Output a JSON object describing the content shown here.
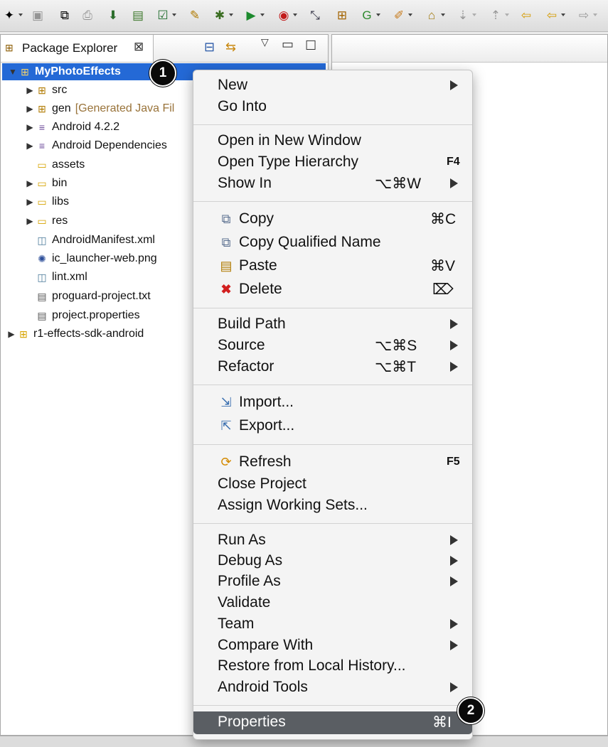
{
  "toolbar": {
    "icons": [
      "new-icon",
      "save-icon",
      "save-all-icon",
      "print-icon",
      "android-sdk-manager-icon",
      "android-avd-manager-icon",
      "checklist-icon",
      "new-java-class-icon",
      "debug-icon",
      "run-icon",
      "run-external-tool-icon",
      "coverage-icon",
      "new-java-package-icon",
      "new-class-icon",
      "open-task-icon",
      "open-type-icon",
      "next-annotation-icon",
      "previous-annotation-icon",
      "back-icon",
      "forward-icon"
    ]
  },
  "package_explorer": {
    "tab_label": "Package Explorer",
    "tree": [
      {
        "label": "MyPhotoEffects",
        "selected": true,
        "expanded": true
      },
      {
        "label": "src"
      },
      {
        "label": "gen",
        "note": "[Generated Java Fil"
      },
      {
        "label": "Android 4.2.2"
      },
      {
        "label": "Android Dependencies"
      },
      {
        "label": "assets"
      },
      {
        "label": "bin"
      },
      {
        "label": "libs"
      },
      {
        "label": "res"
      },
      {
        "label": "AndroidManifest.xml"
      },
      {
        "label": "ic_launcher-web.png"
      },
      {
        "label": "lint.xml"
      },
      {
        "label": "proguard-project.txt"
      },
      {
        "label": "project.properties"
      },
      {
        "label": "r1-effects-sdk-android"
      }
    ]
  },
  "context_menu": {
    "groups": [
      [
        {
          "label": "New",
          "submenu": true
        },
        {
          "label": "Go Into"
        }
      ],
      [
        {
          "label": "Open in New Window"
        },
        {
          "label": "Open Type Hierarchy",
          "shortcut": "F4"
        },
        {
          "label": "Show In",
          "shortcut": "⌥⌘W",
          "submenu": true
        }
      ],
      [
        {
          "label": "Copy",
          "icon": "copy-icon",
          "shortcut": "⌘C"
        },
        {
          "label": "Copy Qualified Name",
          "icon": "copy-qualified-name-icon"
        },
        {
          "label": "Paste",
          "icon": "paste-icon",
          "shortcut": "⌘V"
        },
        {
          "label": "Delete",
          "icon": "delete-icon",
          "shortcut": "⌦"
        }
      ],
      [
        {
          "label": "Build Path",
          "submenu": true
        },
        {
          "label": "Source",
          "shortcut": "⌥⌘S",
          "submenu": true
        },
        {
          "label": "Refactor",
          "shortcut": "⌥⌘T",
          "submenu": true
        }
      ],
      [
        {
          "label": "Import...",
          "icon": "import-icon"
        },
        {
          "label": "Export...",
          "icon": "export-icon"
        }
      ],
      [
        {
          "label": "Refresh",
          "icon": "refresh-icon",
          "shortcut": "F5"
        },
        {
          "label": "Close Project"
        },
        {
          "label": "Assign Working Sets..."
        }
      ],
      [
        {
          "label": "Run As",
          "submenu": true
        },
        {
          "label": "Debug As",
          "submenu": true
        },
        {
          "label": "Profile As",
          "submenu": true
        },
        {
          "label": "Validate"
        },
        {
          "label": "Team",
          "submenu": true
        },
        {
          "label": "Compare With",
          "submenu": true
        },
        {
          "label": "Restore from Local History..."
        },
        {
          "label": "Android Tools",
          "submenu": true
        }
      ],
      [
        {
          "label": "Properties",
          "shortcut": "⌘I",
          "highlighted": true
        }
      ]
    ]
  },
  "annotations": {
    "badge_1": "1",
    "badge_2": "2"
  }
}
